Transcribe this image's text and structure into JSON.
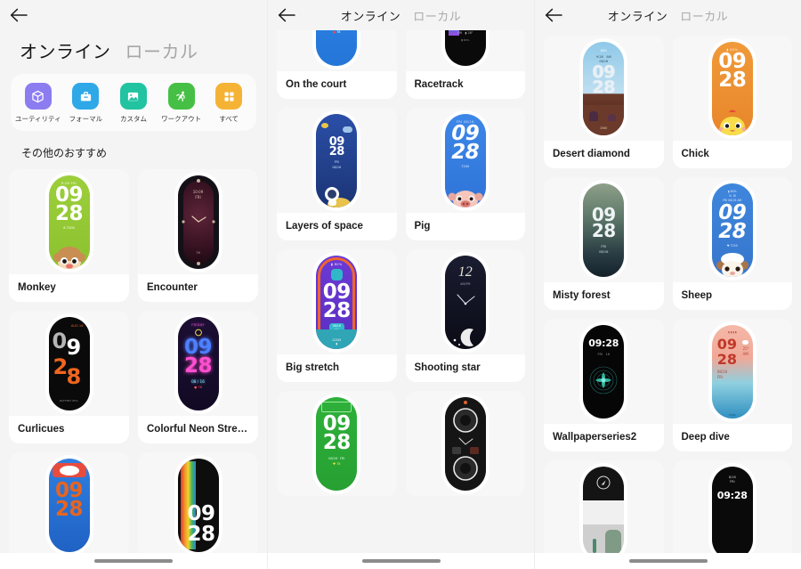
{
  "app": {
    "accent_purple": "#8b7cf0",
    "accent_blue": "#2fa8e8",
    "accent_teal": "#22c3a0",
    "accent_green": "#46bf45",
    "accent_orange": "#f5b335",
    "bg": "#f4f4f4",
    "card_bg": "#f7f7f7",
    "label_bg": "#ffffff"
  },
  "panels": [
    {
      "id": "panel-1",
      "header": {
        "back_icon": "back-arrow-icon",
        "style": "large",
        "tabs": [
          {
            "label": "オンライン",
            "active": true
          },
          {
            "label": "ローカル",
            "active": false
          }
        ]
      },
      "categories": [
        {
          "label": "ユーティリティ",
          "icon": "cube-icon",
          "color": "#8b7cf0"
        },
        {
          "label": "フォーマル",
          "icon": "briefcase-icon",
          "color": "#2fa8e8"
        },
        {
          "label": "カスタム",
          "icon": "image-icon",
          "color": "#22c3a0"
        },
        {
          "label": "ワークアウト",
          "icon": "runner-icon",
          "color": "#46bf45"
        },
        {
          "label": "すべて",
          "icon": "grid-icon",
          "color": "#f5b335"
        }
      ],
      "section_title": "その他のおすすめ",
      "cards": [
        {
          "label": "Monkey",
          "face": "monkey"
        },
        {
          "label": "Encounter",
          "face": "encounter"
        },
        {
          "label": "Curlicues",
          "face": "curlicues"
        },
        {
          "label": "Colorful Neon Street Lig…",
          "face": "neon"
        },
        {
          "label": "",
          "face": "baseball"
        },
        {
          "label": "",
          "face": "rainbow"
        }
      ]
    },
    {
      "id": "panel-2",
      "header": {
        "back_icon": "back-arrow-icon",
        "style": "small",
        "tabs": [
          {
            "label": "オンライン",
            "active": true
          },
          {
            "label": "ローカル",
            "active": false
          }
        ]
      },
      "cards": [
        {
          "label": "On the court",
          "face": "oncourt"
        },
        {
          "label": "Racetrack",
          "face": "racetrack"
        },
        {
          "label": "Layers of space",
          "face": "space"
        },
        {
          "label": "Pig",
          "face": "pig"
        },
        {
          "label": "Big stretch",
          "face": "bigstretch"
        },
        {
          "label": "Shooting star",
          "face": "shootingstar"
        },
        {
          "label": "",
          "face": "greenfield"
        },
        {
          "label": "",
          "face": "gauges"
        }
      ]
    },
    {
      "id": "panel-3",
      "header": {
        "back_icon": "back-arrow-icon",
        "style": "small",
        "tabs": [
          {
            "label": "オンライン",
            "active": true
          },
          {
            "label": "ローカル",
            "active": false
          }
        ]
      },
      "cards": [
        {
          "label": "Desert diamond",
          "face": "desert"
        },
        {
          "label": "Chick",
          "face": "chick"
        },
        {
          "label": "Misty forest",
          "face": "misty"
        },
        {
          "label": "Sheep",
          "face": "sheep"
        },
        {
          "label": "Wallpaperseries2",
          "face": "wallpaper2"
        },
        {
          "label": "Deep dive",
          "face": "deepdive"
        },
        {
          "label": "",
          "face": "compass"
        },
        {
          "label": "",
          "face": "simpledigital"
        }
      ]
    }
  ],
  "watch_faces": {
    "monkey": {
      "time_h": "09",
      "time_m": "28",
      "top": "9:28 FRI",
      "bottom": "8 7200"
    },
    "encounter": {
      "time_h": "",
      "time_m": "",
      "top": "10:09 FRI",
      "bottom": "76"
    },
    "curlicues": {
      "time_h": "09",
      "time_m": "28",
      "top": "AUG 16",
      "bottom": "BATTERY 80%"
    },
    "neon": {
      "time_h": "09",
      "time_m": "28",
      "top": "FRIDAY",
      "bottom": "08 / 16   78"
    },
    "baseball": {
      "time_h": "09",
      "time_m": "28",
      "top": "",
      "bottom": ""
    },
    "rainbow": {
      "time_h": "09",
      "time_m": "28",
      "top": "",
      "bottom": ""
    },
    "oncourt": {
      "time_h": "09",
      "time_m": "28",
      "top": "",
      "bottom": "08/16  FRI   78"
    },
    "racetrack": {
      "time_h": "09",
      "time_m": "28",
      "top": "",
      "bottom": "08/16 AM  FRI  28°  80%"
    },
    "space": {
      "time_h": "09",
      "time_m": "28",
      "top": "",
      "bottom": "FRI 08/16"
    },
    "pig": {
      "time_h": "09",
      "time_m": "28",
      "top": "FRI 08/16",
      "bottom": "7200"
    },
    "bigstretch": {
      "time_h": "09",
      "time_m": "28",
      "top": "80%",
      "bottom": "08/16 FRI"
    },
    "shootingstar": {
      "time_h": "12",
      "time_m": "",
      "top": "AM/PM",
      "bottom": ""
    },
    "greenfield": {
      "time_h": "09",
      "time_m": "28",
      "top": "",
      "bottom": "08/16  FRI   78"
    },
    "gauges": {
      "time_h": "",
      "time_m": "",
      "top": "",
      "bottom": ""
    },
    "desert": {
      "time_h": "09",
      "time_m": "28",
      "top": "9:28  AM  08/16",
      "bottom": "2560"
    },
    "chick": {
      "time_h": "09",
      "time_m": "28",
      "top": "80%",
      "bottom": ""
    },
    "misty": {
      "time_h": "09",
      "time_m": "28",
      "top": "",
      "bottom": "FRI 08/16"
    },
    "sheep": {
      "time_h": "09",
      "time_m": "28",
      "top": "FRI 08/16 AM",
      "bottom": "7200"
    },
    "wallpaper2": {
      "time_h": "09:28",
      "time_m": "",
      "top": "",
      "bottom": "FRI   16"
    },
    "deepdive": {
      "time_h": "09",
      "time_m": "28",
      "top": "25° AM",
      "bottom": "08/16 FRI"
    },
    "compass": {
      "time_h": "",
      "time_m": "",
      "top": "",
      "bottom": ""
    },
    "simpledigital": {
      "time_h": "09:28",
      "time_m": "",
      "top": "8/16 FRI",
      "bottom": ""
    }
  }
}
